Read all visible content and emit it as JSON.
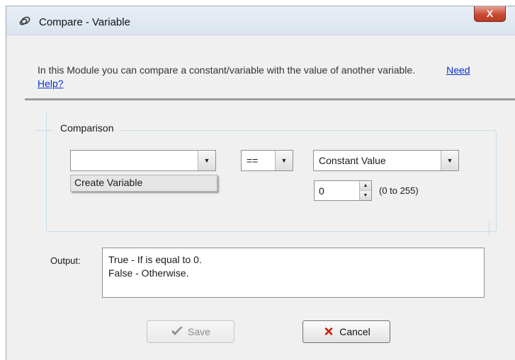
{
  "window": {
    "title": "Compare - Variable",
    "close_label": "X"
  },
  "intro": {
    "text": "In this Module you can compare a constant/variable with the value of another variable.",
    "help_link": "Need Help?"
  },
  "comparison": {
    "legend": "Comparison",
    "left_operand": {
      "value": "",
      "options": [
        "Create Variable"
      ]
    },
    "operator": {
      "value": "=="
    },
    "right_operand_type": {
      "value": "Constant Value"
    },
    "constant": {
      "value": "0",
      "range_label": "(0 to 255)"
    }
  },
  "output": {
    "label": "Output:",
    "line1": "True - If  is equal to 0.",
    "line2": "False - Otherwise."
  },
  "buttons": {
    "save_label": "Save",
    "cancel_label": "Cancel"
  },
  "colors": {
    "link": "#0b31c9",
    "cancel_icon": "#d01e0e",
    "save_icon_disabled": "#8a8a8a",
    "close_button": "#c74a33"
  },
  "icons": {
    "title": "chain-link-icon",
    "save": "checkmark-icon",
    "cancel": "x-icon"
  }
}
